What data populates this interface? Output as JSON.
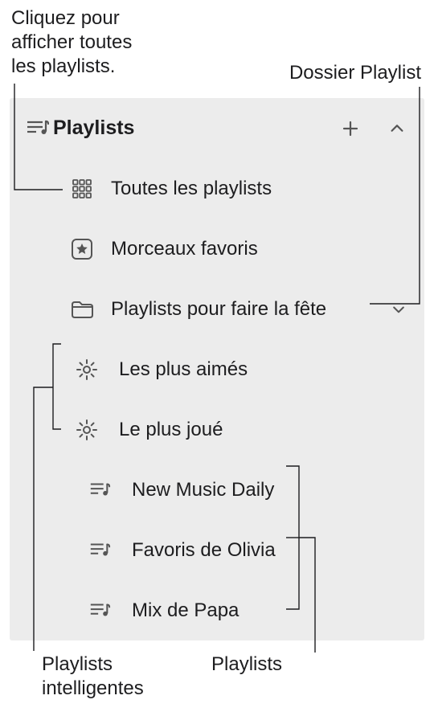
{
  "callouts": {
    "top_left": "Cliquez pour\nafficher toutes\nles playlists.",
    "top_right": "Dossier Playlist",
    "bottom_left": "Playlists\nintelligentes",
    "bottom_right": "Playlists"
  },
  "sidebar": {
    "header": {
      "title": "Playlists"
    },
    "items": [
      {
        "label": "Toutes les playlists"
      },
      {
        "label": "Morceaux favoris"
      },
      {
        "label": "Playlists pour faire la fête"
      },
      {
        "label": "Les plus aimés"
      },
      {
        "label": "Le plus joué"
      },
      {
        "label": "New Music Daily"
      },
      {
        "label": "Favoris de Olivia"
      },
      {
        "label": "Mix de Papa"
      }
    ]
  }
}
